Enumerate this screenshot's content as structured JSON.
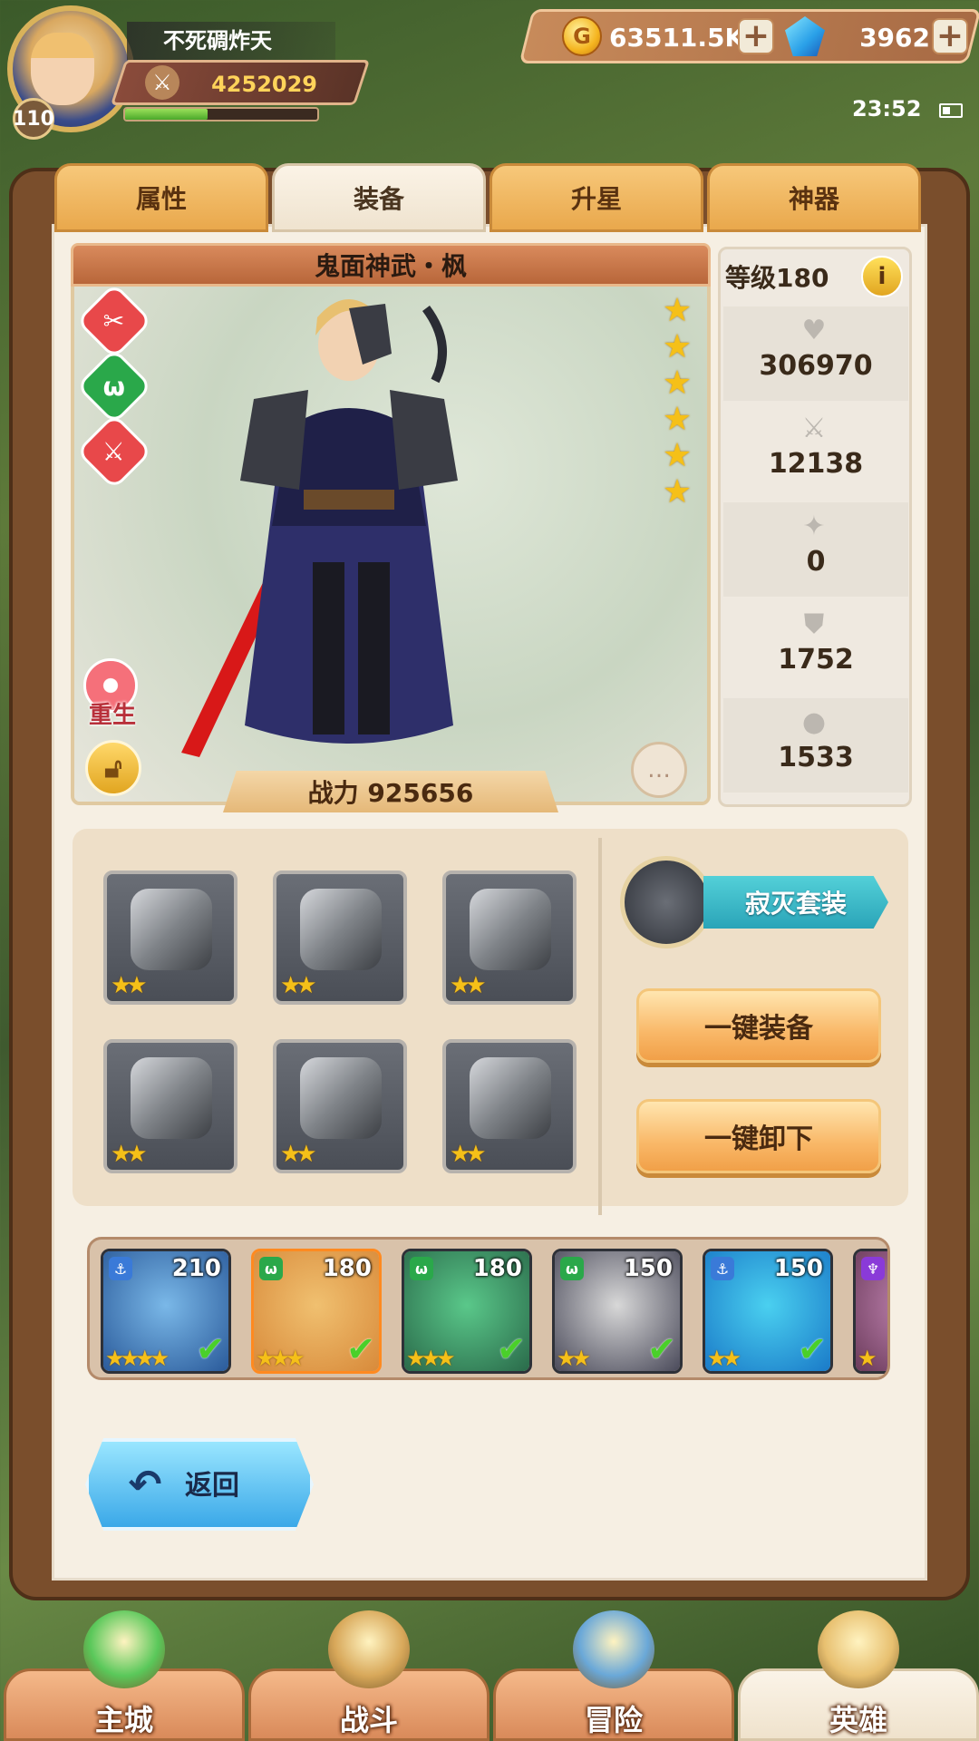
{
  "player": {
    "name": "不死碉炸天",
    "level": "110",
    "power": "4252029",
    "exp_fraction": 0.43
  },
  "resources": {
    "gold": "63511.5K",
    "gems": "3962",
    "plus_symbol": "+"
  },
  "status": {
    "time": "23:52"
  },
  "tabs": [
    {
      "label": "属性",
      "active": false
    },
    {
      "label": "装备",
      "active": true
    },
    {
      "label": "升星",
      "active": false
    },
    {
      "label": "神器",
      "active": false
    }
  ],
  "hero": {
    "name": "鬼面神武・枫",
    "stars": 6,
    "rebirth_label": "重生",
    "combat_power": "战力 925656",
    "skill_icons": [
      "axe-skill-icon",
      "beast-skill-icon",
      "sword-skill-icon"
    ]
  },
  "stats": {
    "level": "等级180",
    "info_symbol": "i",
    "rows": [
      {
        "icon": "heart-icon",
        "glyph": "♥",
        "value": "306970"
      },
      {
        "icon": "attack-icon",
        "glyph": "⚔",
        "value": "12138"
      },
      {
        "icon": "speed-icon",
        "glyph": "✦",
        "value": "0"
      },
      {
        "icon": "armor-icon",
        "glyph": "⛊",
        "value": "1752"
      },
      {
        "icon": "resist-icon",
        "glyph": "●",
        "value": "1533"
      }
    ]
  },
  "equipment": {
    "slots": [
      {
        "name": "helmet",
        "stars": 2
      },
      {
        "name": "weapon-axe",
        "stars": 2
      },
      {
        "name": "chest-armor",
        "stars": 2
      },
      {
        "name": "shield",
        "stars": 2
      },
      {
        "name": "boots",
        "stars": 2
      },
      {
        "name": "ring",
        "stars": 2
      }
    ],
    "set_name": "寂灭套装",
    "equip_all_label": "一键装备",
    "unequip_all_label": "一键卸下"
  },
  "roster": [
    {
      "level": "210",
      "stars": 4,
      "faction": "⚓",
      "faction_color": "#3a7ad8",
      "selected": false,
      "checked": true,
      "colors": [
        "#7ab8e8",
        "#2a5a9a"
      ]
    },
    {
      "level": "180",
      "stars": 3,
      "faction": "ω",
      "faction_color": "#2aa84a",
      "selected": true,
      "checked": true,
      "colors": [
        "#f0c070",
        "#d88a3a"
      ]
    },
    {
      "level": "180",
      "stars": 3,
      "faction": "ω",
      "faction_color": "#2aa84a",
      "selected": false,
      "checked": true,
      "colors": [
        "#5ac88a",
        "#2a6a4a"
      ]
    },
    {
      "level": "150",
      "stars": 2,
      "faction": "ω",
      "faction_color": "#2aa84a",
      "selected": false,
      "checked": true,
      "colors": [
        "#d8d8d8",
        "#4a4a5a"
      ]
    },
    {
      "level": "150",
      "stars": 2,
      "faction": "⚓",
      "faction_color": "#3a7ad8",
      "selected": false,
      "checked": true,
      "colors": [
        "#4ad0f0",
        "#1a7ac8"
      ]
    },
    {
      "level": "",
      "stars": 1,
      "faction": "♆",
      "faction_color": "#8a3ad8",
      "selected": false,
      "checked": false,
      "colors": [
        "#c88ab8",
        "#6a3a5a"
      ]
    }
  ],
  "back": {
    "label": "返回",
    "arrow": "↶"
  },
  "nav": [
    {
      "label": "主城",
      "icon": "city-icon",
      "active": false
    },
    {
      "label": "战斗",
      "icon": "battle-icon",
      "active": false
    },
    {
      "label": "冒险",
      "icon": "adventure-icon",
      "active": false
    },
    {
      "label": "英雄",
      "icon": "hero-icon",
      "active": true
    }
  ]
}
